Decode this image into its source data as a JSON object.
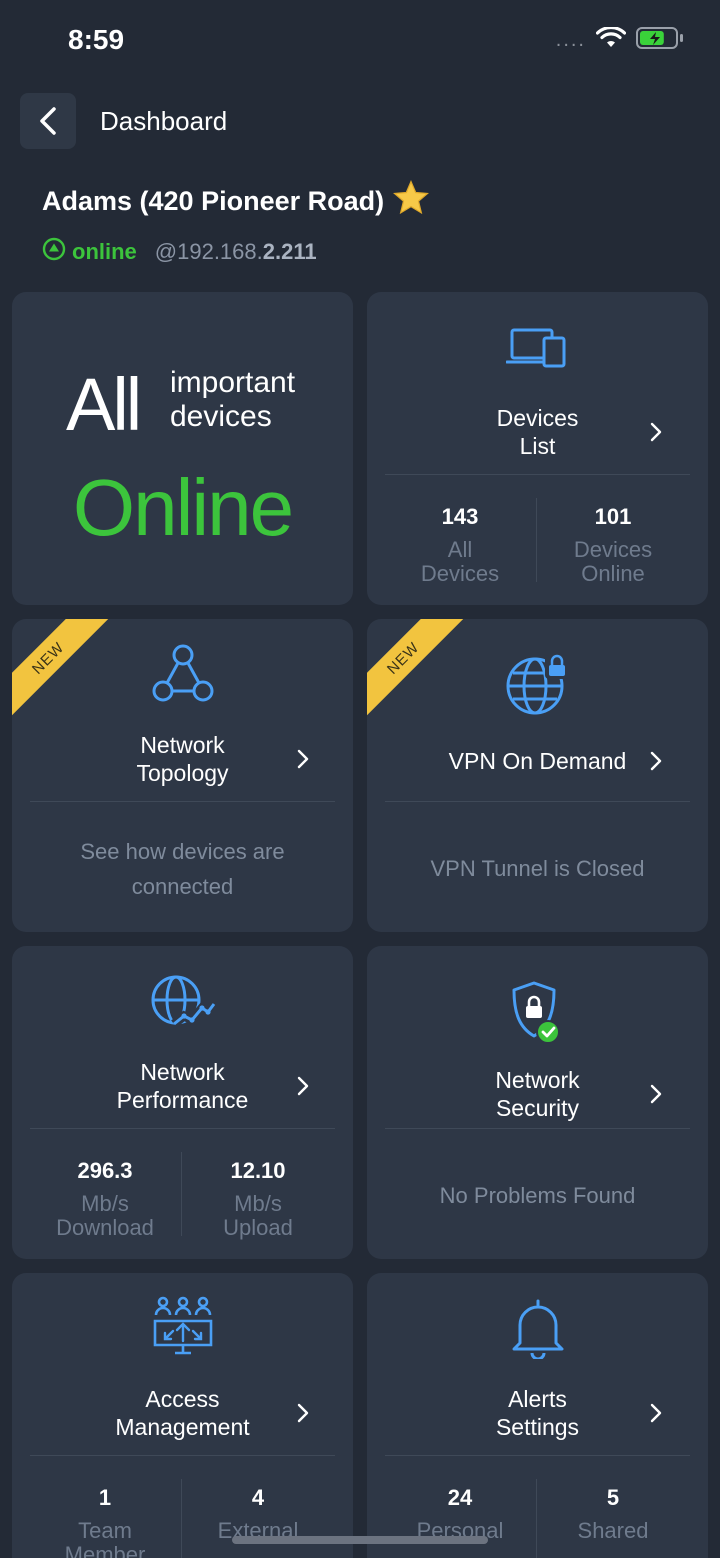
{
  "status_bar": {
    "time": "8:59",
    "signal": "....",
    "battery_level": 0.7
  },
  "header": {
    "title": "Dashboard"
  },
  "site": {
    "name": "Adams (420 Pioneer Road)",
    "status": "online",
    "ip_prefix": "@192.168.",
    "ip_suffix": "2.211"
  },
  "hero": {
    "all": "All",
    "important": "important",
    "devices": "devices",
    "online": "Online"
  },
  "devices_list": {
    "title_line1": "Devices",
    "title_line2": "List",
    "stats": [
      {
        "value": "143",
        "label1": "All",
        "label2": "Devices"
      },
      {
        "value": "101",
        "label1": "Devices",
        "label2": "Online"
      }
    ]
  },
  "network_topology": {
    "badge": "NEW",
    "title_line1": "Network",
    "title_line2": "Topology",
    "desc_line1": "See how devices are",
    "desc_line2": "connected"
  },
  "vpn": {
    "badge": "NEW",
    "title": "VPN On Demand",
    "desc": "VPN Tunnel is Closed"
  },
  "network_performance": {
    "title_line1": "Network",
    "title_line2": "Performance",
    "stats": [
      {
        "value": "296.3",
        "label1": "Mb/s",
        "label2": "Download"
      },
      {
        "value": "12.10",
        "label1": "Mb/s",
        "label2": "Upload"
      }
    ]
  },
  "network_security": {
    "title_line1": "Network",
    "title_line2": "Security",
    "desc": "No Problems Found"
  },
  "access_management": {
    "title_line1": "Access",
    "title_line2": "Management",
    "stats": [
      {
        "value": "1",
        "label1": "Team",
        "label2": "Member"
      },
      {
        "value": "4",
        "label1": "External",
        "label2": ""
      }
    ]
  },
  "alerts_settings": {
    "title_line1": "Alerts",
    "title_line2": "Settings",
    "stats": [
      {
        "value": "24",
        "label1": "Personal",
        "label2": ""
      },
      {
        "value": "5",
        "label1": "Shared",
        "label2": ""
      }
    ]
  },
  "colors": {
    "accent": "#4a9ff5",
    "online": "#3cc43c",
    "badge": "#f2c43f",
    "card": "#2e3746",
    "background": "#232a36"
  }
}
